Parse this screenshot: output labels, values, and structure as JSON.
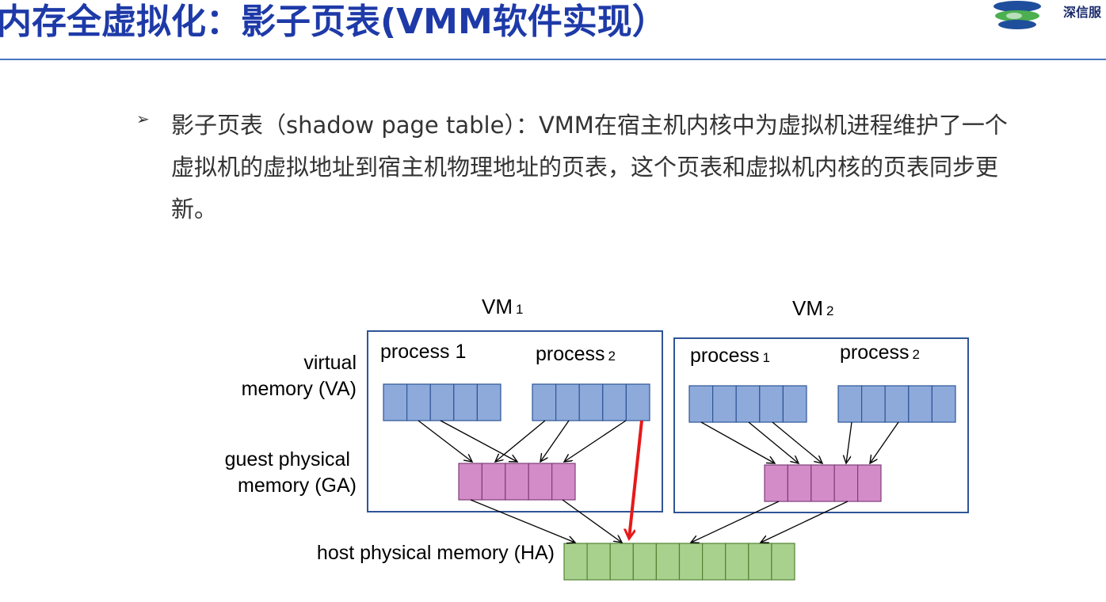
{
  "header": {
    "title": "内存全虚拟化：影子页表(VMM软件实现）",
    "logo_text": "深信服"
  },
  "bullet": {
    "marker": "➢",
    "text": "影子页表（shadow page table）：VMM在宿主机内核中为虚拟机进程维护了一个虚拟机的虚拟地址到宿主机物理地址的页表，这个页表和虚拟机内核的页表同步更新。"
  },
  "diagram": {
    "row_labels": {
      "virtual_line1": "virtual",
      "virtual_line2": "memory (VA)",
      "guest_line1": "guest physical",
      "guest_line2": "memory (GA)",
      "host": "host physical memory (HA)"
    },
    "vm1": {
      "label": "VM",
      "index": "1",
      "process_a": {
        "label": "process 1",
        "index": ""
      },
      "process_b": {
        "label": "process",
        "index": "2"
      }
    },
    "vm2": {
      "label": "VM",
      "index": "2",
      "process_a": {
        "label": "process",
        "index": "1"
      },
      "process_b": {
        "label": "process",
        "index": "2"
      }
    },
    "colors": {
      "virtual_cell": "#8eaadb",
      "guest_cell": "#d48cc8",
      "host_cell": "#a9d18e",
      "box_border": "#2f5597",
      "shadow_arrow": "#e61919",
      "title": "#1e3aa8"
    }
  }
}
